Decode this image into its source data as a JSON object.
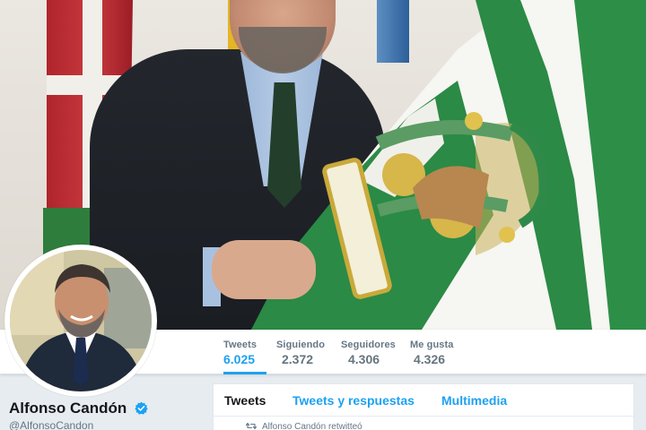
{
  "stats": [
    {
      "label": "Tweets",
      "value": "6.025",
      "active": true
    },
    {
      "label": "Siguiendo",
      "value": "2.372",
      "active": false
    },
    {
      "label": "Seguidores",
      "value": "4.306",
      "active": false
    },
    {
      "label": "Me gusta",
      "value": "4.326",
      "active": false
    }
  ],
  "profile": {
    "name": "Alfonso Candón",
    "handle": "@AlfonsoCandon",
    "verified": true
  },
  "tabs": [
    {
      "label": "Tweets",
      "current": true
    },
    {
      "label": "Tweets y respuestas",
      "current": false
    },
    {
      "label": "Multimedia",
      "current": false
    }
  ],
  "timeline": {
    "retweet_text": "Alfonso Candón retwitteó"
  },
  "colors": {
    "accent": "#1da1f2",
    "verified": "#1da1f2",
    "text_primary": "#14171a",
    "text_secondary": "#657786",
    "background": "#e6ecf0"
  },
  "icons": {
    "verified": "verified-badge-icon",
    "retweet": "retweet-icon"
  }
}
